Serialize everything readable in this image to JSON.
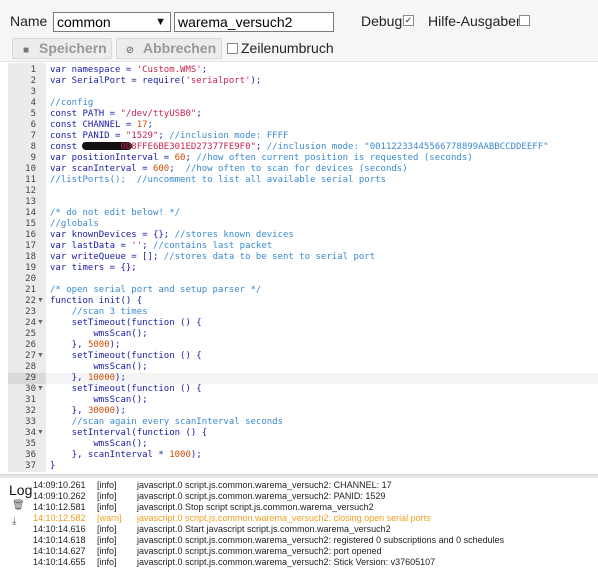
{
  "header": {
    "name_label": "Name",
    "script_select": "common",
    "script_name": "warema_versuch2",
    "debug_label": "Debug",
    "debug_checked": true,
    "help_label": "Hilfe-Ausgaben",
    "help_checked": false
  },
  "toolbar": {
    "save_label": "Speichern",
    "cancel_label": "Abbrechen",
    "wrap_label": "Zeilenumbruch",
    "wrap_checked": false
  },
  "editor": {
    "active_line": 29,
    "lines": [
      "var namespace = 'Custom.WMS';",
      "var SerialPort = require('serialport');",
      "",
      "//config",
      "const PATH = \"/dev/ttyUSB0\";",
      "const CHANNEL = 17;",
      "const PANID = \"1529\"; //inclusion mode: FFFF",
      "const KEY = \"[redacted]0D8FFE6BE301ED27377FE9F0\"; //inclusion mode: \"00112233445566778899AABBCCDDEEFF\"",
      "var positionInterval = 60; //how often current position is requested (seconds)",
      "var scanInterval = 600;  //how often to scan for devices (seconds)",
      "//listPorts();  //uncomment to list all available serial ports",
      "",
      "",
      "/* do not edit below! */",
      "//globals",
      "var knownDevices = {}; //stores known devices",
      "var lastData = ''; //contains last packet",
      "var writeQueue = []; //stores data to be sent to serial port",
      "var timers = {};",
      "",
      "/* open serial port and setup parser */",
      "function init() {",
      "    //scan 3 times",
      "    setTimeout(function () {",
      "        wmsScan();",
      "    }, 5000);",
      "    setTimeout(function () {",
      "        wmsScan();",
      "    }, 10000);",
      "    setTimeout(function () {",
      "        wmsScan();",
      "    }, 30000);",
      "    //scan again every scanInterval seconds",
      "    setInterval(function () {",
      "        wmsScan();",
      "    }, scanInterval * 1000);",
      "}"
    ]
  },
  "log": {
    "title": "Log",
    "entries": [
      {
        "time": "14:09:10.261",
        "level": "[info]",
        "message": "javascript.0 script.js.common.warema_versuch2: CHANNEL: 17"
      },
      {
        "time": "14:09:10.262",
        "level": "[info]",
        "message": "javascript.0 script.js.common.warema_versuch2: PANID: 1529"
      },
      {
        "time": "14:10:12.581",
        "level": "[info]",
        "message": "javascript.0 Stop script script.js.common.warema_versuch2"
      },
      {
        "time": "14:10:12.582",
        "level": "[warn]",
        "message": "javascript.0 script.js.common.warema_versuch2: closing open serial ports"
      },
      {
        "time": "14:10:14.616",
        "level": "[info]",
        "message": "javascript.0 Start javascript script.js.common.warema_versuch2"
      },
      {
        "time": "14:10:14.618",
        "level": "[info]",
        "message": "javascript.0 script.js.common.warema_versuch2: registered 0 subscriptions and 0 schedules"
      },
      {
        "time": "14:10:14.627",
        "level": "[info]",
        "message": "javascript.0 script.js.common.warema_versuch2: port opened"
      },
      {
        "time": "14:10:14.655",
        "level": "[info]",
        "message": "javascript.0 script.js.common.warema_versuch2: Stick Version: v37605107"
      }
    ]
  }
}
